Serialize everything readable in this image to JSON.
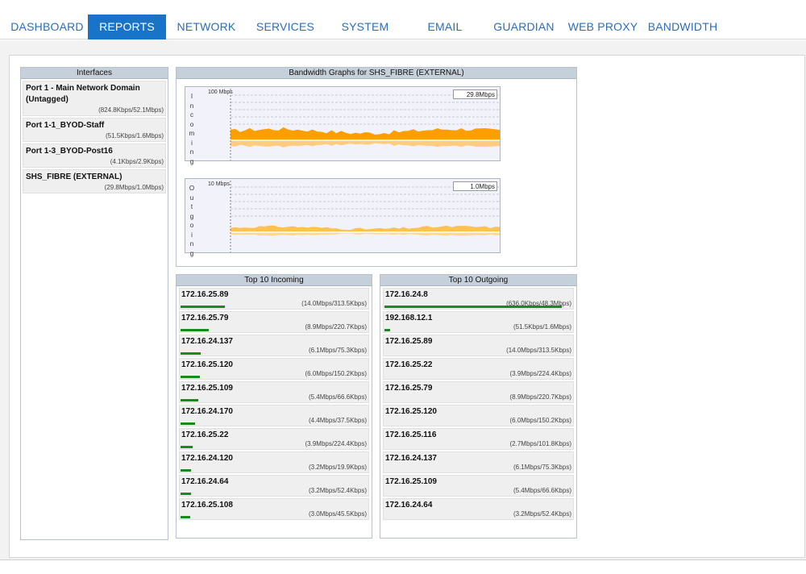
{
  "nav": {
    "tabs": [
      {
        "label": "DASHBOARD"
      },
      {
        "label": "REPORTS"
      },
      {
        "label": "NETWORK"
      },
      {
        "label": "SERVICES"
      },
      {
        "label": "SYSTEM"
      },
      {
        "label": "EMAIL"
      },
      {
        "label": "GUARDIAN"
      },
      {
        "label": "WEB PROXY"
      },
      {
        "label": "BANDWIDTH"
      }
    ],
    "active": "REPORTS"
  },
  "interfaces": {
    "title": "Interfaces",
    "items": [
      {
        "name": "Port 1 - Main Network Domain (Untagged)",
        "rate": "(824.8Kbps/52.1Mbps)"
      },
      {
        "name": "Port 1-1_BYOD-Staff",
        "rate": "(51.5Kbps/1.6Mbps)"
      },
      {
        "name": "Port 1-3_BYOD-Post16",
        "rate": "(4.1Kbps/2.9Kbps)"
      },
      {
        "name": "SHS_FIBRE (EXTERNAL)",
        "rate": "(29.8Mbps/1.0Mbps)"
      }
    ]
  },
  "graphs": {
    "title": "Bandwidth Graphs for SHS_FIBRE (EXTERNAL)",
    "incoming": {
      "label": "Incoming",
      "max": "100 Mbps",
      "current": "29.8Mbps",
      "color": "#ff9e00",
      "mirror_color": "#ffcc80"
    },
    "outgoing": {
      "label": "Outgoing",
      "max": "10 Mbps",
      "current": "1.0Mbps",
      "color": "#ffc34d",
      "mirror_color": "#ffd98a"
    }
  },
  "top_incoming": {
    "title": "Top 10 Incoming",
    "rows": [
      {
        "ip": "172.16.25.89",
        "rate": "(14.0Mbps/313.5Kbps)",
        "level": 0.235
      },
      {
        "ip": "172.16.25.79",
        "rate": "(8.9Mbps/220.7Kbps)",
        "level": 0.15
      },
      {
        "ip": "172.16.24.137",
        "rate": "(6.1Mbps/75.3Kbps)",
        "level": 0.105
      },
      {
        "ip": "172.16.25.120",
        "rate": "(6.0Mbps/150.2Kbps)",
        "level": 0.103
      },
      {
        "ip": "172.16.25.109",
        "rate": "(5.4Mbps/66.6Kbps)",
        "level": 0.092
      },
      {
        "ip": "172.16.24.170",
        "rate": "(4.4Mbps/37.5Kbps)",
        "level": 0.075
      },
      {
        "ip": "172.16.25.22",
        "rate": "(3.9Mbps/224.4Kbps)",
        "level": 0.066
      },
      {
        "ip": "172.16.24.120",
        "rate": "(3.2Mbps/19.9Kbps)",
        "level": 0.055
      },
      {
        "ip": "172.16.24.64",
        "rate": "(3.2Mbps/52.4Kbps)",
        "level": 0.055
      },
      {
        "ip": "172.16.25.108",
        "rate": "(3.0Mbps/45.5Kbps)",
        "level": 0.05
      }
    ]
  },
  "top_outgoing": {
    "title": "Top 10 Outgoing",
    "rows": [
      {
        "ip": "172.16.24.8",
        "rate": "(636.0Kbps/48.3Mbps)",
        "level": 0.94
      },
      {
        "ip": "192.168.12.1",
        "rate": "(51.5Kbps/1.6Mbps)",
        "level": 0.032
      },
      {
        "ip": "172.16.25.89",
        "rate": "(14.0Mbps/313.5Kbps)",
        "level": 0.0
      },
      {
        "ip": "172.16.25.22",
        "rate": "(3.9Mbps/224.4Kbps)",
        "level": 0.0
      },
      {
        "ip": "172.16.25.79",
        "rate": "(8.9Mbps/220.7Kbps)",
        "level": 0.0
      },
      {
        "ip": "172.16.25.120",
        "rate": "(6.0Mbps/150.2Kbps)",
        "level": 0.0
      },
      {
        "ip": "172.16.25.116",
        "rate": "(2.7Mbps/101.8Kbps)",
        "level": 0.0
      },
      {
        "ip": "172.16.24.137",
        "rate": "(6.1Mbps/75.3Kbps)",
        "level": 0.0
      },
      {
        "ip": "172.16.25.109",
        "rate": "(5.4Mbps/66.6Kbps)",
        "level": 0.0
      },
      {
        "ip": "172.16.24.64",
        "rate": "(3.2Mbps/52.4Kbps)",
        "level": 0.0
      }
    ]
  }
}
